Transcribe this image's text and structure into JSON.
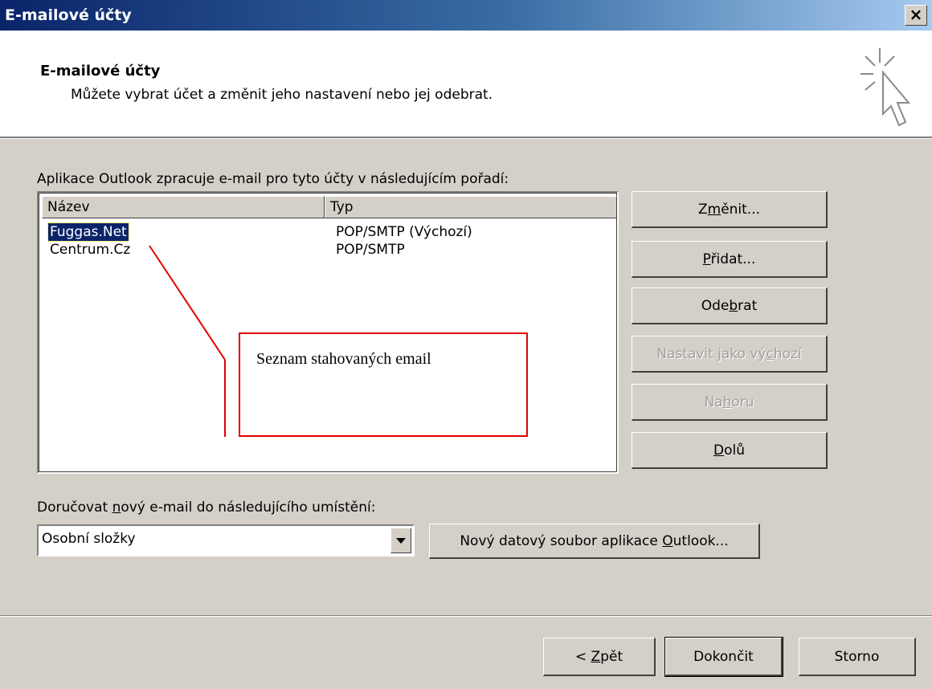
{
  "window": {
    "title": "E-mailové účty",
    "close_label": "×"
  },
  "header": {
    "title": "E-mailové účty",
    "description": "Můžete vybrat účet a změnit jeho nastavení nebo jej odebrat."
  },
  "accounts": {
    "order_label": "Aplikace Outlook zpracuje e-mail pro tyto účty v následujícím pořadí:",
    "columns": [
      "Název",
      "Typ"
    ],
    "rows": [
      {
        "name": "Fuggas.Net",
        "type": "POP/SMTP (Výchozí)",
        "selected": true
      },
      {
        "name": "Centrum.Cz",
        "type": "POP/SMTP",
        "selected": false
      }
    ]
  },
  "side_buttons": {
    "change": {
      "pre": "Z",
      "key": "m",
      "post": "ěnit...",
      "enabled": true
    },
    "add": {
      "pre": "",
      "key": "P",
      "post": "řidat...",
      "enabled": true
    },
    "remove": {
      "pre": "Ode",
      "key": "b",
      "post": "rat",
      "enabled": true
    },
    "set_default": {
      "pre": "Nastavit jako vý",
      "key": "c",
      "post": "hozí",
      "enabled": false
    },
    "up": {
      "pre": "Na",
      "key": "h",
      "post": "oru",
      "enabled": false
    },
    "down": {
      "pre": "",
      "key": "D",
      "post": "olů",
      "enabled": true
    }
  },
  "delivery": {
    "label_pre": "Doručovat ",
    "label_key": "n",
    "label_post": "ový e-mail do následujícího umístění:",
    "selected": "Osobní složky",
    "new_file_pre": "Nový datový soubor aplikace ",
    "new_file_key": "O",
    "new_file_post": "utlook..."
  },
  "footer": {
    "back_pre": "< ",
    "back_key": "Z",
    "back_post": "pět",
    "finish": "Dokončit",
    "cancel": "Storno"
  },
  "annotation": {
    "text": "Seznam stahovaných email",
    "color": "#e00000"
  }
}
